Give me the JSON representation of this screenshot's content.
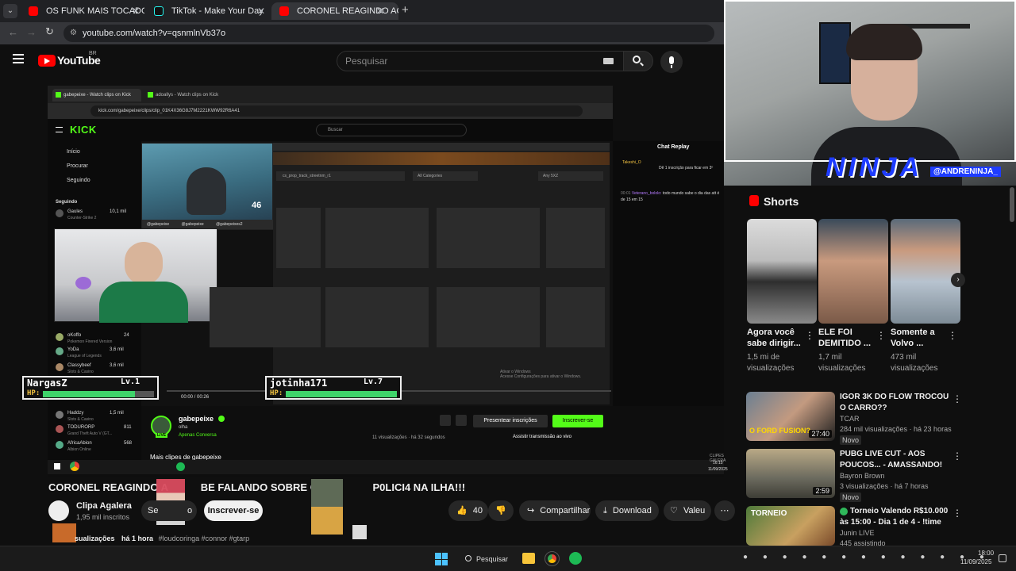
{
  "browser": {
    "tabs": [
      {
        "title": "OS FUNK MAIS TOCADOS DE 2",
        "active": false
      },
      {
        "title": "TikTok - Make Your Day",
        "active": false
      },
      {
        "title": "CORONEL REAGINDO AO",
        "active": true
      }
    ],
    "url": "youtube.com/watch?v=qsnmlnVb37o"
  },
  "youtube": {
    "logo_text": "YouTube",
    "country": "BR",
    "search_placeholder": "Pesquisar"
  },
  "kick": {
    "tabs": [
      "gabepeixe - Watch clips on Kick",
      "adoallys - Watch clips on Kick"
    ],
    "url": "kick.com/gabepeixe/clips/clip_01K4X36G8J7M2221KWW92R6A41",
    "logo": "KICK",
    "search_placeholder": "Buscar",
    "nav": [
      "Início",
      "Procurar",
      "Seguindo"
    ],
    "following_header": "Seguindo",
    "channels": [
      {
        "name": "Gaules",
        "game": "Counter-Strike 2",
        "count": "10,1 mil"
      },
      {
        "name": "oKoffo",
        "game": "Pokemon Firered Version",
        "count": "24"
      },
      {
        "name": "YoDa",
        "game": "League of Legends",
        "count": "3,6 mil"
      },
      {
        "name": "Classybeef",
        "game": "Slots & Casino",
        "count": "3,6 mil"
      },
      {
        "name": "Haddzy",
        "game": "Slots & Casino",
        "count": "1,5 mil"
      },
      {
        "name": "TODURORP",
        "game": "Grand Theft Auto V (GT...",
        "count": "811"
      },
      {
        "name": "AfricaAbion",
        "game": "Albion Online",
        "count": "568"
      }
    ],
    "chat_title": "Chat Replay",
    "chat_user": "Takeshi_O",
    "chat_sub_text": "Dê 1 inscrição para ficar em 3º",
    "chat_msg_time": "00:01",
    "chat_msg_user": "Veterano_bololo:",
    "chat_msg_text": "todo mundo sabe o dia das att é de 15 em 15",
    "streamer": "gabepeixe",
    "streamer_sub": "olha",
    "streamer_sub2": "Apenas Conversa",
    "live_badge": "LIVE",
    "gift_btn": "Presentear inscrições",
    "subscribe_btn": "Inscrever-se",
    "views": "11 visualizações",
    "views_time": "há 32 segundos",
    "watch_live": "Assistir transmissão ao vivo",
    "time": "00:00 / 00:26",
    "more_clips": "Mais clipes de gabepeixe",
    "grid_search": "cs_prop_track_streetnm_r1",
    "grid_filter1": "All Categories",
    "grid_filter2": "Any 5XZ",
    "windows_watermark": "Ativar o Windows",
    "windows_watermark2": "Acesse Configurações para ativar o Windows.",
    "webcam_handles": [
      "@gabepeixe",
      "@gabepeixe",
      "@gabepeixes2"
    ],
    "cam_counter": "46",
    "tray_time": "16:15",
    "tray_date": "11/09/2025",
    "tray_label": "CLIPES GALERA"
  },
  "overlays": {
    "hp1_name": "NargasZ",
    "hp1_level": "Lv.1",
    "hp2_name": "jotinha171",
    "hp2_level": "Lv.7",
    "hp_label": "HP:"
  },
  "video": {
    "title": "CORONEL REAGINDO A",
    "title_mid": "BE FALANDO SOBRE COLO",
    "title_end": "P0LICI4 NA ILHA!!!",
    "channel": "Clipa Agalera",
    "subscribers": "1,95 mil inscritos",
    "join_fragment_left": "Se",
    "join_fragment_right": "o",
    "subscribe": "Inscrever-se",
    "likes": "40",
    "share": "Compartilhar",
    "download": "Download",
    "thanks": "Valeu",
    "meta_views": "sualizações",
    "meta_time": "há 1 hora",
    "hashtags": "#loudcoringa #connor #gtarp"
  },
  "webcam": {
    "brand": "NINJA",
    "handle": "@ANDRENINJA_"
  },
  "shorts": {
    "header": "Shorts",
    "items": [
      {
        "title": "Agora você sabe dirigir...",
        "views": "1,5 mi de visualizações"
      },
      {
        "title": "ELE FOI DEMITIDO ...",
        "views": "1,7 mil visualizações"
      },
      {
        "title": "Somente a Volvo ...",
        "views": "473 mil visualizações"
      }
    ]
  },
  "recommended": [
    {
      "title": "IGOR 3K DO FLOW TROCOU O CARRO??",
      "channel": "TCAR",
      "meta": "284 mil visualizações · há 23 horas",
      "badge": "Novo",
      "duration": "27:40",
      "thumb_text": "O FORD FUSION?"
    },
    {
      "title": "PUBG LIVE CUT - AOS POUCOS... - AMASSANDO!",
      "channel": "Bayron Brown",
      "meta": "3 visualizações · há 7 horas",
      "badge": "Novo",
      "duration": "2:59",
      "thumb_text": ""
    },
    {
      "title": "Torneio Valendo R$10.000 às 15:00 - Dia 1 de 4 - !time",
      "channel": "Junin LIVE",
      "meta": "445 assistindo",
      "badge": "",
      "duration": "",
      "thumb_text": "TORNEIO"
    }
  ],
  "taskbar": {
    "search": "Pesquisar",
    "time": "18:00",
    "date": "11/09/2025"
  },
  "colors": {
    "yt_red": "#ff0000",
    "kick_green": "#53fc18",
    "hp_green": "#3fd36a",
    "bg": "#0f0f0f"
  }
}
